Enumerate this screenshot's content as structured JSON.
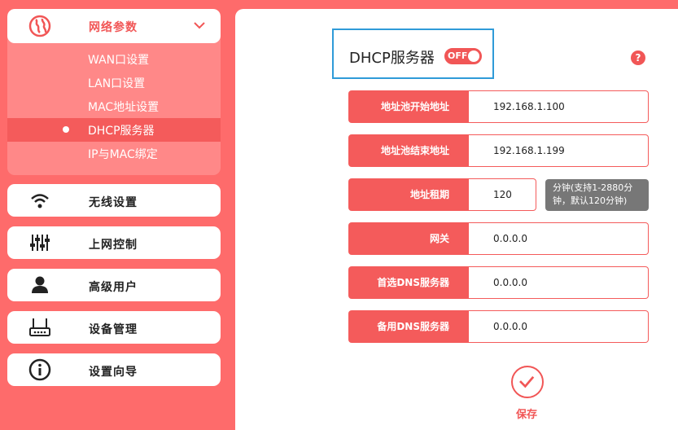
{
  "sidebar": {
    "network": {
      "label": "网络参数",
      "icon": "globe-icon",
      "items": [
        {
          "label": "WAN口设置"
        },
        {
          "label": "LAN口设置"
        },
        {
          "label": "MAC地址设置"
        },
        {
          "label": "DHCP服务器",
          "active": true
        },
        {
          "label": "IP与MAC绑定"
        }
      ]
    },
    "items": [
      {
        "label": "无线设置",
        "icon": "wifi-icon"
      },
      {
        "label": "上网控制",
        "icon": "sliders-icon"
      },
      {
        "label": "高级用户",
        "icon": "user-icon"
      },
      {
        "label": "设备管理",
        "icon": "router-icon"
      },
      {
        "label": "设置向导",
        "icon": "info-icon"
      }
    ]
  },
  "main": {
    "title": "DHCP服务器",
    "toggle": "OFF",
    "help": "?",
    "fields": [
      {
        "label": "地址池开始地址",
        "value": "192.168.1.100"
      },
      {
        "label": "地址池结束地址",
        "value": "192.168.1.199"
      },
      {
        "label": "地址租期",
        "value": "120"
      },
      {
        "label": "网关",
        "value": "0.0.0.0"
      },
      {
        "label": "首选DNS服务器",
        "value": "0.0.0.0"
      },
      {
        "label": "备用DNS服务器",
        "value": "0.0.0.0"
      }
    ],
    "lease_hint_line1": "分钟(支持1-2880分",
    "lease_hint_line2": "钟，默认120分钟)",
    "save_label": "保存"
  },
  "colors": {
    "accent": "#f15656",
    "background": "#fe6b6b",
    "highlight_border": "#2f9bd8"
  }
}
